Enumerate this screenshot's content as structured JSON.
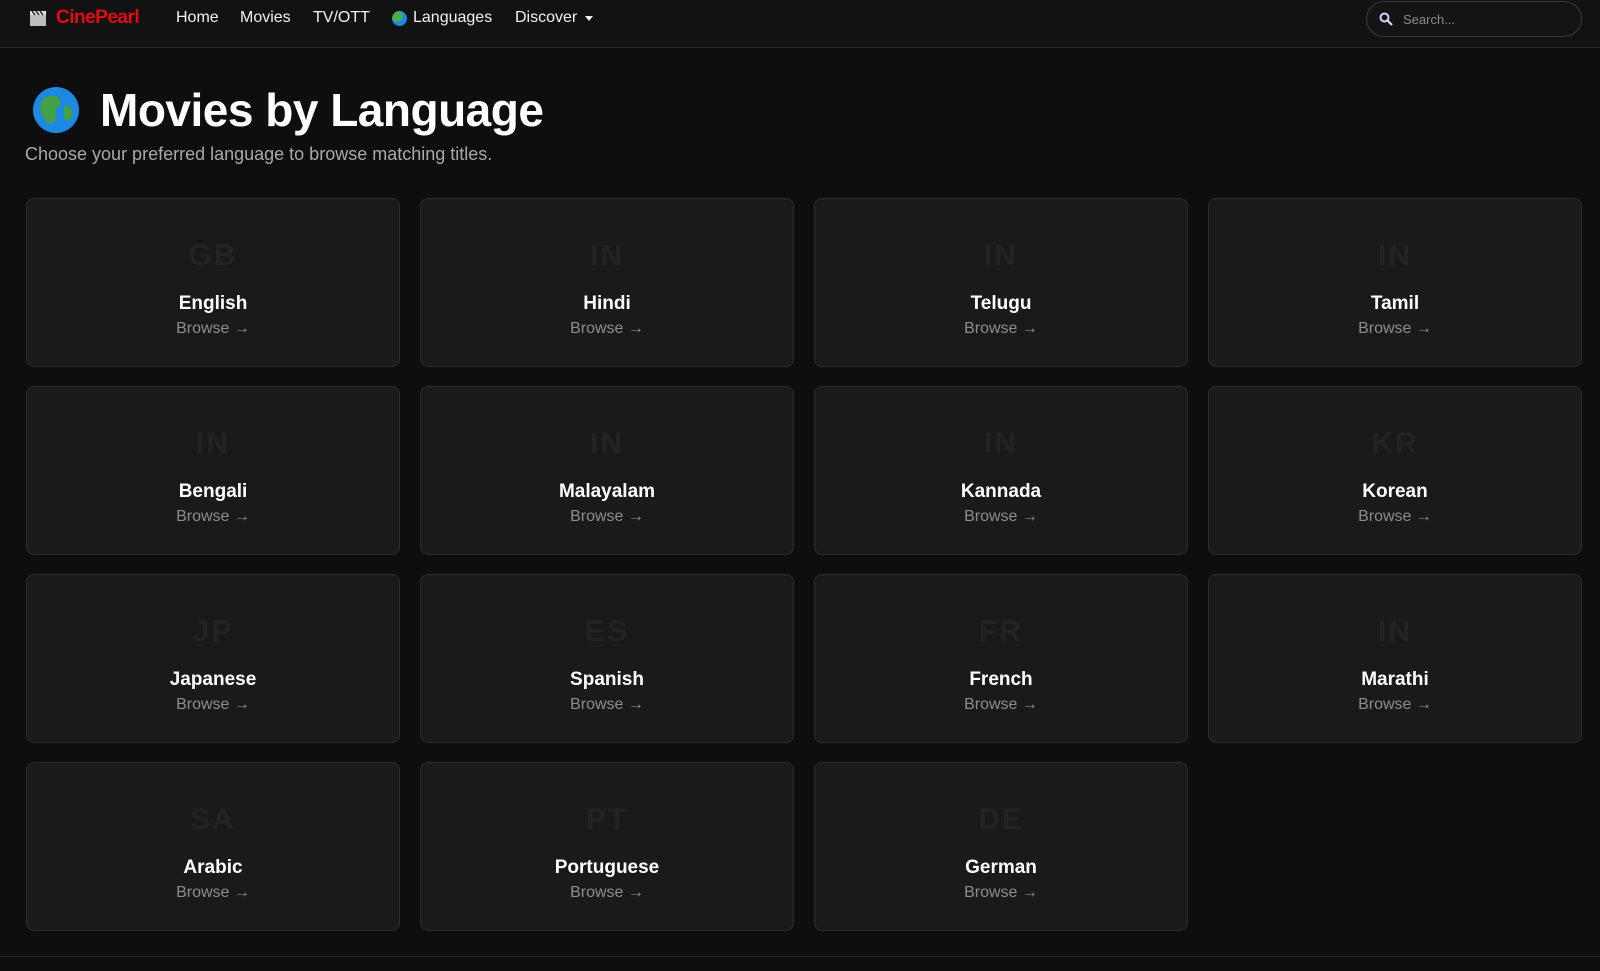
{
  "brand": {
    "name": "CinePearl",
    "color": "#e50914",
    "icon": "clapperboard-icon"
  },
  "nav": {
    "home": "Home",
    "movies": "Movies",
    "tv": "TV/OTT",
    "languages": "Languages",
    "discover": "Discover"
  },
  "search": {
    "placeholder": "Search..."
  },
  "page": {
    "title": "Movies by Language",
    "subtitle": "Choose your preferred language to browse matching titles."
  },
  "languages": [
    {
      "code": "GB",
      "name": "English",
      "action": "Browse →"
    },
    {
      "code": "IN",
      "name": "Hindi",
      "action": "Browse →"
    },
    {
      "code": "IN",
      "name": "Telugu",
      "action": "Browse →"
    },
    {
      "code": "IN",
      "name": "Tamil",
      "action": "Browse →"
    },
    {
      "code": "IN",
      "name": "Bengali",
      "action": "Browse →"
    },
    {
      "code": "IN",
      "name": "Malayalam",
      "action": "Browse →"
    },
    {
      "code": "IN",
      "name": "Kannada",
      "action": "Browse →"
    },
    {
      "code": "KR",
      "name": "Korean",
      "action": "Browse →"
    },
    {
      "code": "JP",
      "name": "Japanese",
      "action": "Browse →"
    },
    {
      "code": "ES",
      "name": "Spanish",
      "action": "Browse →"
    },
    {
      "code": "FR",
      "name": "French",
      "action": "Browse →"
    },
    {
      "code": "IN",
      "name": "Marathi",
      "action": "Browse →"
    },
    {
      "code": "SA",
      "name": "Arabic",
      "action": "Browse →"
    },
    {
      "code": "PT",
      "name": "Portuguese",
      "action": "Browse →"
    },
    {
      "code": "DE",
      "name": "German",
      "action": "Browse →"
    }
  ]
}
